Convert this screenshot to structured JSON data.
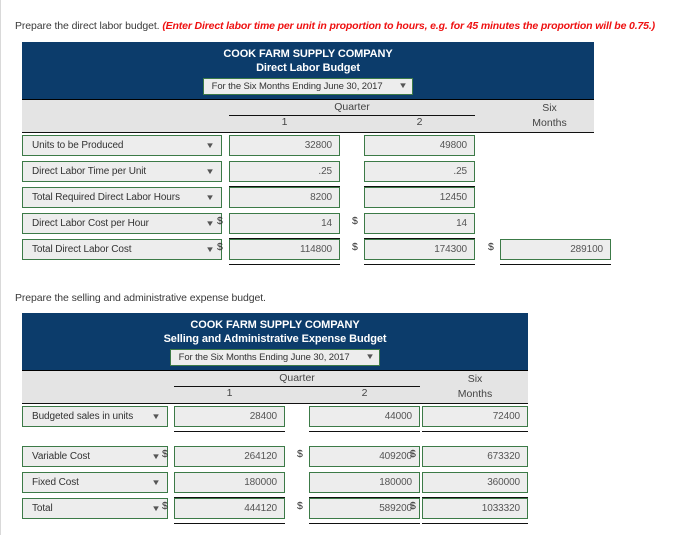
{
  "instructions": {
    "first": "Prepare the direct labor budget.",
    "first_hint": "(Enter Direct labor time per unit in proportion to hours, e.g. for 45 minutes the proportion will be 0.75.)",
    "second": "Prepare the selling and administrative expense budget."
  },
  "colors": {
    "header_bg": "#0c3c6b",
    "colhead_bg": "#e4e4e4",
    "field_border": "#3c7a47",
    "field_bg": "#ededed",
    "hint_text": "#ee1111"
  },
  "icons": {
    "caret": "▼"
  },
  "table1": {
    "company": "COOK FARM SUPPLY COMPANY",
    "title": "Direct Labor Budget",
    "period": "For the Six Months Ending June 30, 2017",
    "group_header": "Quarter",
    "col1": "1",
    "col2": "2",
    "six": "Six",
    "months": "Months",
    "rows": [
      {
        "label": "Units to be Produced",
        "q1": "32800",
        "q2": "49800",
        "six": "",
        "q1_dollar": false,
        "q2_dollar": false,
        "six_dollar": false,
        "six_shown": false,
        "rule_after": false
      },
      {
        "label": "Direct Labor Time per Unit",
        "q1": ".25",
        "q2": ".25",
        "six": "",
        "q1_dollar": false,
        "q2_dollar": false,
        "six_dollar": false,
        "six_shown": false,
        "rule_after": true
      },
      {
        "label": "Total Required Direct Labor Hours",
        "q1": "8200",
        "q2": "12450",
        "six": "",
        "q1_dollar": false,
        "q2_dollar": false,
        "six_dollar": false,
        "six_shown": false,
        "rule_after": false
      },
      {
        "label": "Direct Labor Cost per Hour",
        "q1": "14",
        "q2": "14",
        "six": "",
        "q1_dollar": true,
        "q2_dollar": true,
        "six_dollar": false,
        "six_shown": false,
        "rule_after": true
      },
      {
        "label": "Total Direct Labor Cost",
        "q1": "114800",
        "q2": "174300",
        "six": "289100",
        "q1_dollar": true,
        "q2_dollar": true,
        "six_dollar": true,
        "six_shown": true,
        "rule_after": true
      }
    ]
  },
  "table2": {
    "company": "COOK FARM SUPPLY COMPANY",
    "title": "Selling and Administrative Expense Budget",
    "period": "For the Six Months Ending June 30, 2017",
    "group_header": "Quarter",
    "col1": "1",
    "col2": "2",
    "six": "Six",
    "months": "Months",
    "rows": [
      {
        "label": "Budgeted sales in units",
        "q1": "28400",
        "q2": "44000",
        "six": "72400",
        "q1_dollar": false,
        "q2_dollar": false,
        "six_dollar": false,
        "six_shown": true,
        "rule_after": true
      },
      {
        "label": "Variable Cost",
        "q1": "264120",
        "q2": "409200",
        "six": "673320",
        "q1_dollar": true,
        "q2_dollar": true,
        "six_dollar": true,
        "six_shown": true,
        "rule_after": false
      },
      {
        "label": "Fixed Cost",
        "q1": "180000",
        "q2": "180000",
        "six": "360000",
        "q1_dollar": false,
        "q2_dollar": false,
        "six_dollar": false,
        "six_shown": true,
        "rule_after": true
      },
      {
        "label": "Total",
        "q1": "444120",
        "q2": "589200",
        "six": "1033320",
        "q1_dollar": true,
        "q2_dollar": true,
        "six_dollar": true,
        "six_shown": true,
        "rule_after": true
      }
    ]
  }
}
